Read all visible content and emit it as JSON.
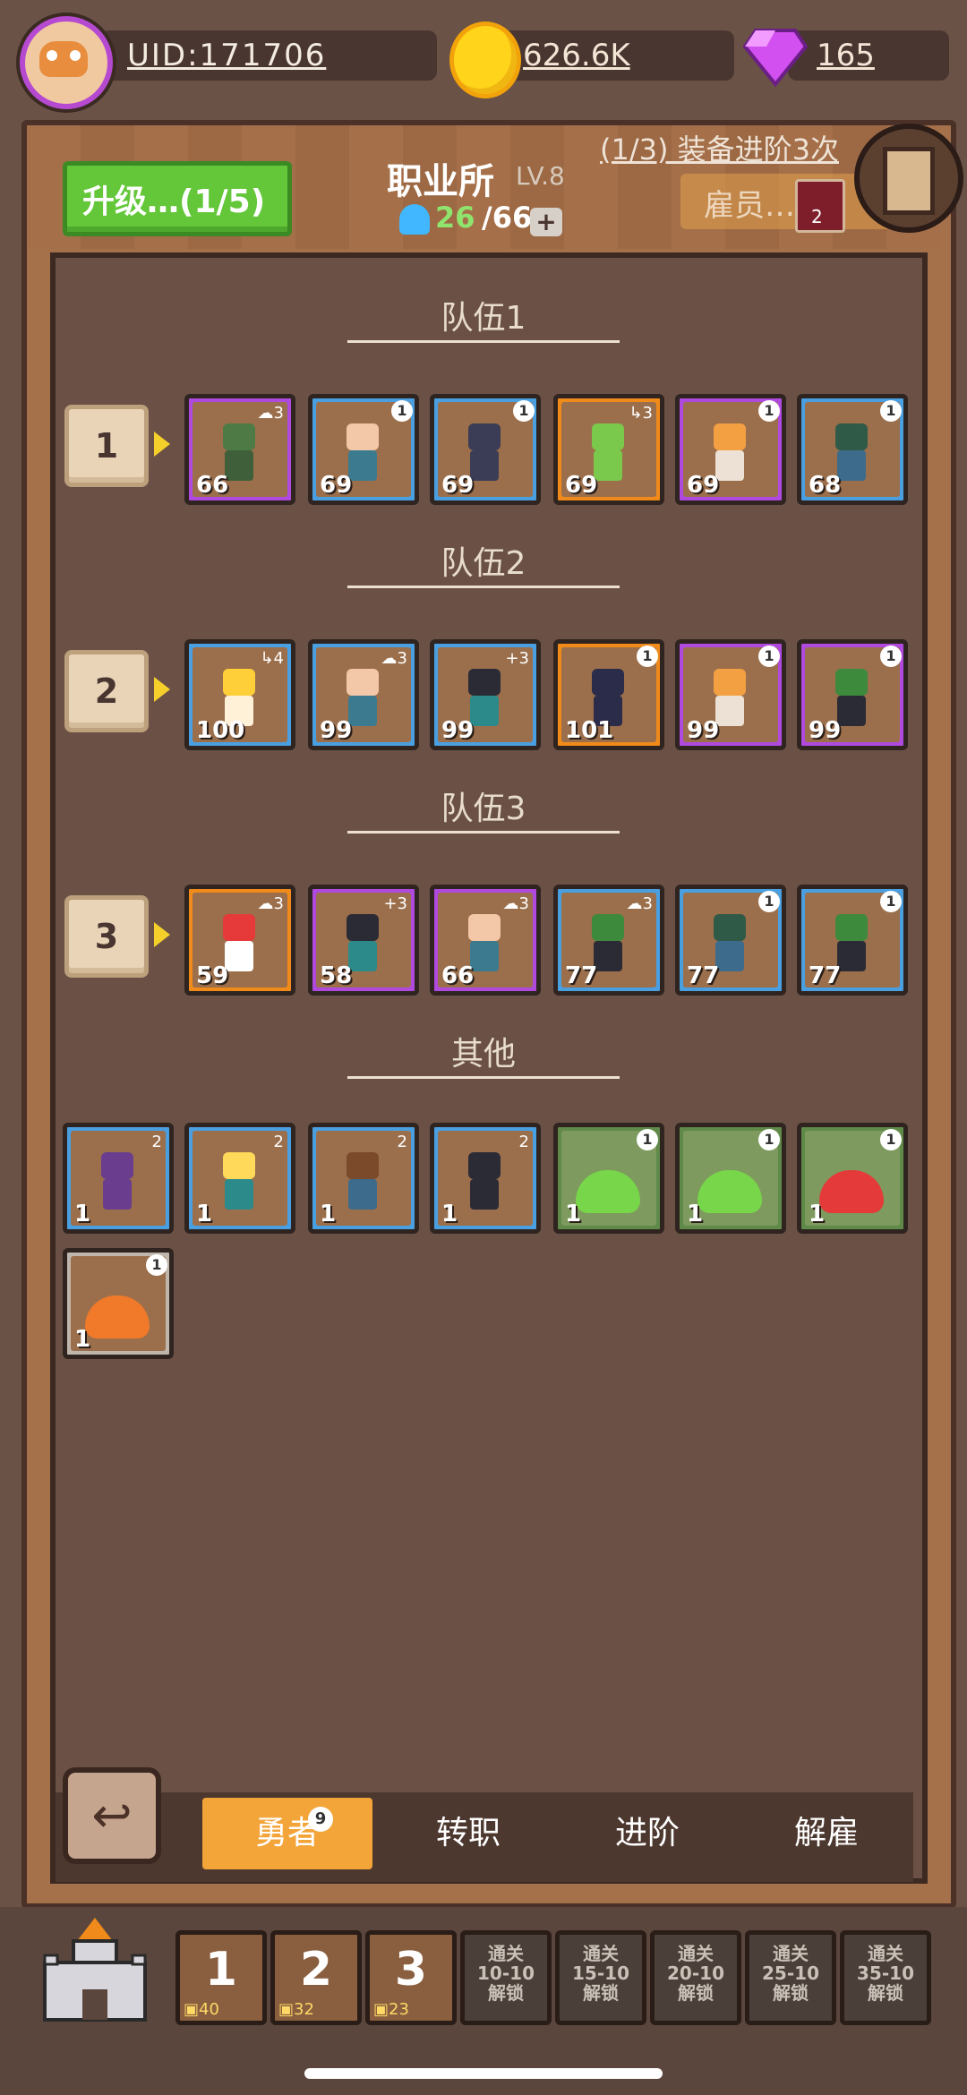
{
  "top": {
    "uid": "UID:171706",
    "gold": "626.6K",
    "gems": "165"
  },
  "header": {
    "upgrade_label": "升级…(1/5)",
    "title": "职业所",
    "level": "LV.8",
    "pop_current": "26",
    "pop_max": "/66",
    "plus": "+",
    "quest": "(1/3) 装备进阶3次",
    "hire_tab": "雇员…",
    "key_count": "2"
  },
  "teams": [
    {
      "title": "队伍1",
      "badge": "1",
      "members": [
        {
          "lvl": "66",
          "rarity": "purple",
          "tag": "☁3",
          "head": "#4d7a45",
          "body": "#3f5f3a"
        },
        {
          "lvl": "69",
          "rarity": "blue",
          "tag": "1",
          "head": "#f2c8a8",
          "body": "#3c7b8f"
        },
        {
          "lvl": "69",
          "rarity": "blue",
          "tag": "1",
          "head": "#3a3d55",
          "body": "#3a3d55"
        },
        {
          "lvl": "69",
          "rarity": "orange",
          "tag": "↳3",
          "head": "#7bc94c",
          "body": "#7bc94c"
        },
        {
          "lvl": "69",
          "rarity": "purple",
          "tag": "1",
          "head": "#f3a042",
          "body": "#ece1d4"
        },
        {
          "lvl": "68",
          "rarity": "blue",
          "tag": "1",
          "head": "#2f5a47",
          "body": "#3c6b8b"
        }
      ]
    },
    {
      "title": "队伍2",
      "badge": "2",
      "members": [
        {
          "lvl": "100",
          "rarity": "blue",
          "tag": "↳4",
          "head": "#ffcf3a",
          "body": "#fff0d8"
        },
        {
          "lvl": "99",
          "rarity": "blue",
          "tag": "☁3",
          "head": "#f2c8a8",
          "body": "#3c7b8f"
        },
        {
          "lvl": "99",
          "rarity": "blue",
          "tag": "+3",
          "head": "#2b2b36",
          "body": "#2c8a8a"
        },
        {
          "lvl": "101",
          "rarity": "orange",
          "tag": "1",
          "head": "#2b2b4a",
          "body": "#2b2b4a"
        },
        {
          "lvl": "99",
          "rarity": "purple",
          "tag": "1",
          "head": "#f3a042",
          "body": "#ece1d4"
        },
        {
          "lvl": "99",
          "rarity": "purple",
          "tag": "1",
          "head": "#3d8a3d",
          "body": "#2b2b36"
        }
      ]
    },
    {
      "title": "队伍3",
      "badge": "3",
      "members": [
        {
          "lvl": "59",
          "rarity": "orange",
          "tag": "☁3",
          "head": "#e63a3a",
          "body": "#ffffff"
        },
        {
          "lvl": "58",
          "rarity": "purple",
          "tag": "+3",
          "head": "#2b2b36",
          "body": "#2c8a8a"
        },
        {
          "lvl": "66",
          "rarity": "purple",
          "tag": "☁3",
          "head": "#f2c8a8",
          "body": "#3c7b8f"
        },
        {
          "lvl": "77",
          "rarity": "blue",
          "tag": "☁3",
          "head": "#3d8a3d",
          "body": "#2b2b36"
        },
        {
          "lvl": "77",
          "rarity": "blue",
          "tag": "1",
          "head": "#2f5a47",
          "body": "#3c6b8b"
        },
        {
          "lvl": "77",
          "rarity": "blue",
          "tag": "1",
          "head": "#3d8a3d",
          "body": "#2b2b36"
        }
      ]
    }
  ],
  "others": {
    "title": "其他",
    "members": [
      {
        "lvl": "1",
        "rarity": "blue",
        "tag": "2",
        "head": "#6a3d8f",
        "body": "#6a3d8f",
        "kind": "hero"
      },
      {
        "lvl": "1",
        "rarity": "blue",
        "tag": "2",
        "head": "#ffd95a",
        "body": "#2c8a8a",
        "kind": "hero"
      },
      {
        "lvl": "1",
        "rarity": "blue",
        "tag": "2",
        "head": "#7a4a2b",
        "body": "#3c6b8b",
        "kind": "hero"
      },
      {
        "lvl": "1",
        "rarity": "blue",
        "tag": "2",
        "head": "#2b2b36",
        "body": "#2b2b36",
        "kind": "hero"
      },
      {
        "lvl": "1",
        "rarity": "slime",
        "tag": "1",
        "color": "#78d64a",
        "kind": "slime"
      },
      {
        "lvl": "1",
        "rarity": "slime",
        "tag": "1",
        "color": "#78d64a",
        "kind": "slime"
      },
      {
        "lvl": "1",
        "rarity": "slime",
        "tag": "1",
        "color": "#e43a3a",
        "kind": "slime"
      },
      {
        "lvl": "1",
        "rarity": "gray",
        "tag": "1",
        "color": "#f07a2a",
        "kind": "slime"
      }
    ]
  },
  "tabs": {
    "hero": "勇者",
    "hero_badge": "9",
    "promote": "转职",
    "advance": "进阶",
    "dismiss": "解雇"
  },
  "stages": [
    {
      "n": "1",
      "chest": "40"
    },
    {
      "n": "2",
      "chest": "32"
    },
    {
      "n": "3",
      "chest": "23"
    }
  ],
  "locked": [
    {
      "l1": "通关",
      "l2": "10-10",
      "l3": "解锁"
    },
    {
      "l1": "通关",
      "l2": "15-10",
      "l3": "解锁"
    },
    {
      "l1": "通关",
      "l2": "20-10",
      "l3": "解锁"
    },
    {
      "l1": "通关",
      "l2": "25-10",
      "l3": "解锁"
    },
    {
      "l1": "通关",
      "l2": "35-10",
      "l3": "解锁"
    }
  ]
}
